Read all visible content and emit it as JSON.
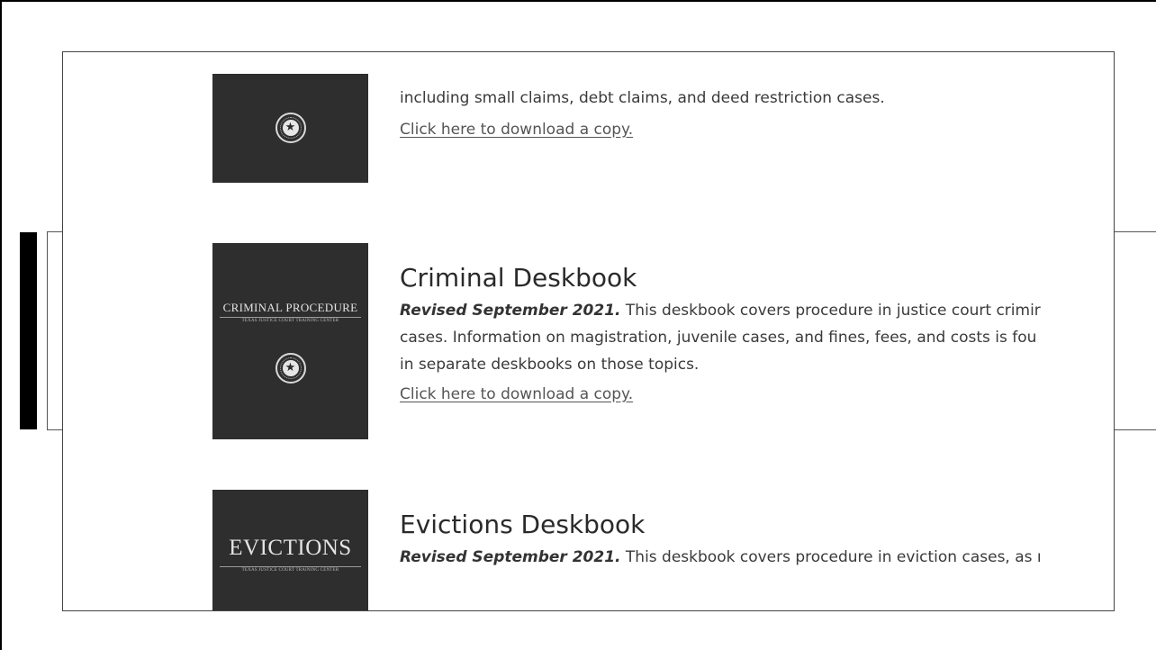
{
  "items": [
    {
      "cover_title": "",
      "cover_subtitle": "",
      "description_tail": "including small claims, debt claims, and deed restriction cases.",
      "link": "Click here to download a copy."
    },
    {
      "cover_title": "CRIMINAL PROCEDURE",
      "cover_subtitle": "TEXAS JUSTICE COURT TRAINING CENTER",
      "heading": "Criminal Deskbook",
      "revised": "Revised September 2021.",
      "lines": [
        " This deskbook covers procedure in justice court crimir",
        "cases. Information on magistration, juvenile cases, and fines, fees, and costs is fou",
        "in separate deskbooks on those topics."
      ],
      "link": "Click here to download a copy."
    },
    {
      "cover_title": "EVICTIONS",
      "cover_subtitle": "TEXAS JUSTICE COURT TRAINING CENTER",
      "heading": "Evictions Deskbook",
      "revised": "Revised September 2021.",
      "lines": [
        " This deskbook covers procedure in eviction cases, as ı"
      ]
    }
  ],
  "icons": {
    "seal": "star-seal-icon"
  },
  "colors": {
    "cover_bg": "#2e2e2e",
    "text": "#333333",
    "link": "#555555"
  }
}
